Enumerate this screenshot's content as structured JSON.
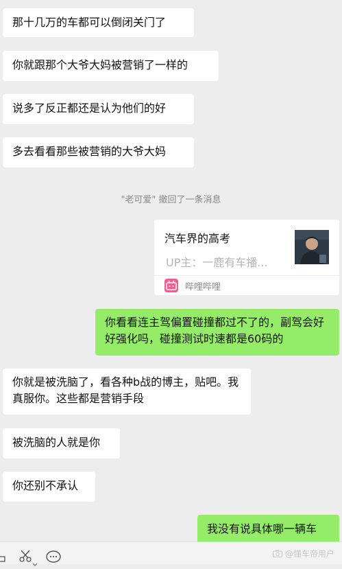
{
  "messages": [
    {
      "text": "那十几万的车都可以倒闭关门了"
    },
    {
      "text": "你就跟那个大爷大妈被营销了一样的"
    },
    {
      "text": "说多了反正都还是认为他们的好"
    },
    {
      "text": "多去看看那些被营销的大爷大妈"
    },
    {
      "text": "你看看连主驾偏置碰撞都过不了的，副驾会好好强化吗，碰撞测试时速都是60码的"
    },
    {
      "text": "你就是被洗脑了，看各种b战的博主，贴吧。我真服你。这些都是营销手段"
    },
    {
      "text": "被洗脑的人就是你"
    },
    {
      "text": "你还别不承认"
    },
    {
      "text": "我没有说具体哪一辆车"
    }
  ],
  "recall_notice": "\"老可爱\" 撤回了一条消息",
  "share_card": {
    "title": "汽车界的高考",
    "subtitle": "UP主：一鹿有车播...",
    "source": "哔哩哔哩",
    "logo_text": "bilibili"
  },
  "watermark": "@懂车帝用户",
  "colors": {
    "background": "#ededed",
    "incoming_bubble": "#ffffff",
    "outgoing_bubble": "#95ec69"
  }
}
